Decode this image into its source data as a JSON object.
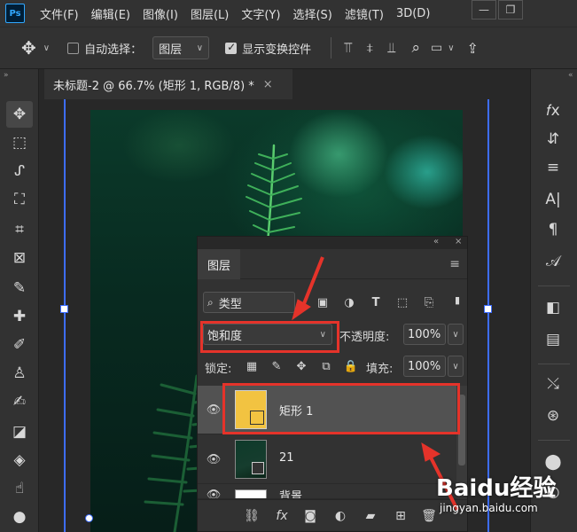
{
  "app": {
    "logo": "Ps"
  },
  "menu": [
    "文件(F)",
    "编辑(E)",
    "图像(I)",
    "图层(L)",
    "文字(Y)",
    "选择(S)",
    "滤镜(T)",
    "3D(D)"
  ],
  "window_controls": {
    "minimize": "—",
    "restore": "❐"
  },
  "options_bar": {
    "auto_select_label": "自动选择：",
    "auto_select_checked": false,
    "auto_select_target": "图层",
    "show_transform_label": "显示变换控件",
    "show_transform_checked": true
  },
  "document_tab": {
    "title": "未标题-2 @ 66.7% (矩形 1, RGB/8) *",
    "close": "×"
  },
  "layers_panel": {
    "tab_label": "图层",
    "filter_kind": "类型",
    "blend_mode": "饱和度",
    "opacity_label": "不透明度:",
    "opacity_value": "100%",
    "lock_label": "锁定:",
    "fill_label": "填充:",
    "fill_value": "100%",
    "layers": [
      {
        "name": "矩形 1",
        "selected": true,
        "thumb": "yellow-rect"
      },
      {
        "name": "21",
        "selected": false,
        "thumb": "fern-photo"
      },
      {
        "name": "背景",
        "selected": false,
        "thumb": "white"
      }
    ]
  },
  "colors": {
    "selection_red": "#e5332a",
    "guide_blue": "#3d6dff",
    "rect_yellow": "#f2c341"
  },
  "watermark": {
    "logo": "Baidu经验",
    "url": "jingyan.baidu.com"
  }
}
